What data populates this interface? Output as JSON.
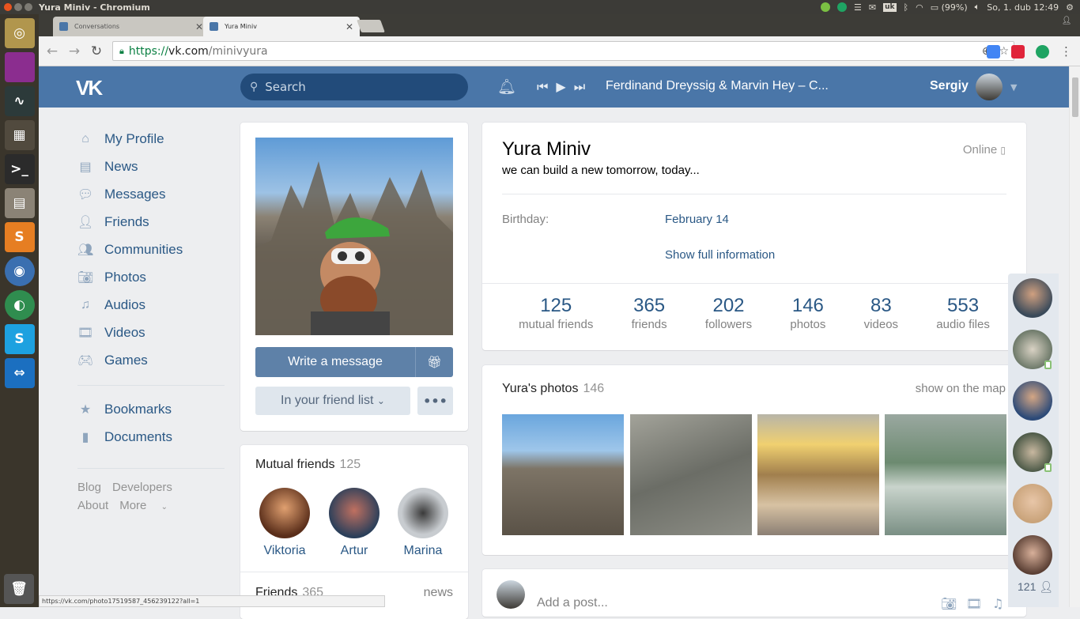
{
  "os": {
    "window_title": "Yura Miniv - Chromium",
    "lang": "uk",
    "battery": "(99%)",
    "clock": "So, 1. dub 12:49"
  },
  "browser": {
    "tabs": [
      {
        "label": "Conversations",
        "active": false
      },
      {
        "label": "Yura Miniv",
        "active": true
      }
    ],
    "url_scheme": "https://",
    "url_host": "vk.com",
    "url_path": "/minivyura",
    "status_url": "https://vk.com/photo17519587_456239122?all=1"
  },
  "header": {
    "logo": "VK",
    "search_placeholder": "Search",
    "track": "Ferdinand Dreyssig & Marvin Hey – C...",
    "user_name": "Sergiy"
  },
  "nav": {
    "items": [
      {
        "label": "My Profile",
        "icon": "home-icon"
      },
      {
        "label": "News",
        "icon": "news-icon"
      },
      {
        "label": "Messages",
        "icon": "messages-icon"
      },
      {
        "label": "Friends",
        "icon": "friends-icon"
      },
      {
        "label": "Communities",
        "icon": "communities-icon"
      },
      {
        "label": "Photos",
        "icon": "camera-icon"
      },
      {
        "label": "Audios",
        "icon": "music-icon"
      },
      {
        "label": "Videos",
        "icon": "film-icon"
      },
      {
        "label": "Games",
        "icon": "gamepad-icon"
      }
    ],
    "extra": [
      {
        "label": "Bookmarks",
        "icon": "star-icon"
      },
      {
        "label": "Documents",
        "icon": "document-icon"
      }
    ],
    "footer": {
      "blog": "Blog",
      "developers": "Developers",
      "about": "About",
      "more": "More"
    }
  },
  "profile": {
    "write_message": "Write a message",
    "friend_status": "In your friend list",
    "name": "Yura Miniv",
    "status": "we can build a new tomorrow, today...",
    "online": "Online",
    "birthday_label": "Birthday:",
    "birthday_value": "February 14",
    "show_full": "Show full information",
    "counters": [
      {
        "n": "125",
        "l": "mutual friends"
      },
      {
        "n": "365",
        "l": "friends"
      },
      {
        "n": "202",
        "l": "followers"
      },
      {
        "n": "146",
        "l": "photos"
      },
      {
        "n": "83",
        "l": "videos"
      },
      {
        "n": "553",
        "l": "audio files"
      }
    ]
  },
  "mutual": {
    "title": "Mutual friends",
    "count": "125",
    "people": [
      {
        "name": "Viktoria"
      },
      {
        "name": "Artur"
      },
      {
        "name": "Marina"
      }
    ]
  },
  "friends": {
    "title": "Friends",
    "count": "365",
    "news": "news"
  },
  "photos": {
    "title": "Yura's photos",
    "count": "146",
    "map_link": "show on the map"
  },
  "post": {
    "placeholder": "Add a post..."
  },
  "online_sidebar": {
    "count": "121"
  },
  "colors": {
    "vk_blue": "#4a76a8",
    "link": "#2a5885"
  }
}
